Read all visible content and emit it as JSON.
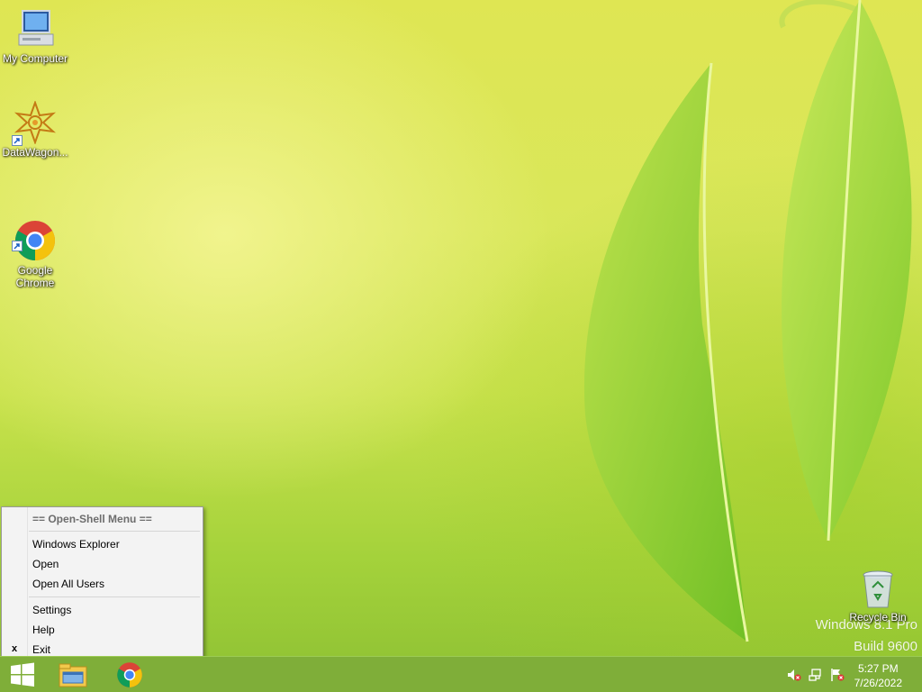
{
  "desktop": {
    "icons": [
      {
        "label": "My Computer"
      },
      {
        "label": "DataWagon..."
      },
      {
        "label": "Google\nChrome"
      },
      {
        "label": "Recycle Bin"
      }
    ],
    "watermark": {
      "line1": "Windows 8.1 Pro",
      "line2": "Build 9600"
    }
  },
  "menu": {
    "title": "== Open-Shell Menu ==",
    "items": [
      {
        "label": "Windows Explorer"
      },
      {
        "label": "Open"
      },
      {
        "label": "Open All Users"
      },
      {
        "label": "Settings"
      },
      {
        "label": "Help"
      },
      {
        "label": "Exit",
        "mark": "x"
      }
    ]
  },
  "taskbar": {
    "buttons": [
      {
        "icon": "windows-start-icon"
      },
      {
        "icon": "file-explorer-icon"
      },
      {
        "icon": "chrome-icon"
      }
    ],
    "tray": {
      "icons": [
        "volume-muted-icon",
        "network-icon",
        "action-center-flag-icon"
      ]
    },
    "clock": {
      "time": "5:27 PM",
      "date": "7/26/2022"
    }
  },
  "colors": {
    "taskbar": "#7fae39",
    "menu_bg": "#f3f3f3",
    "wallpaper": "#dfe653"
  }
}
